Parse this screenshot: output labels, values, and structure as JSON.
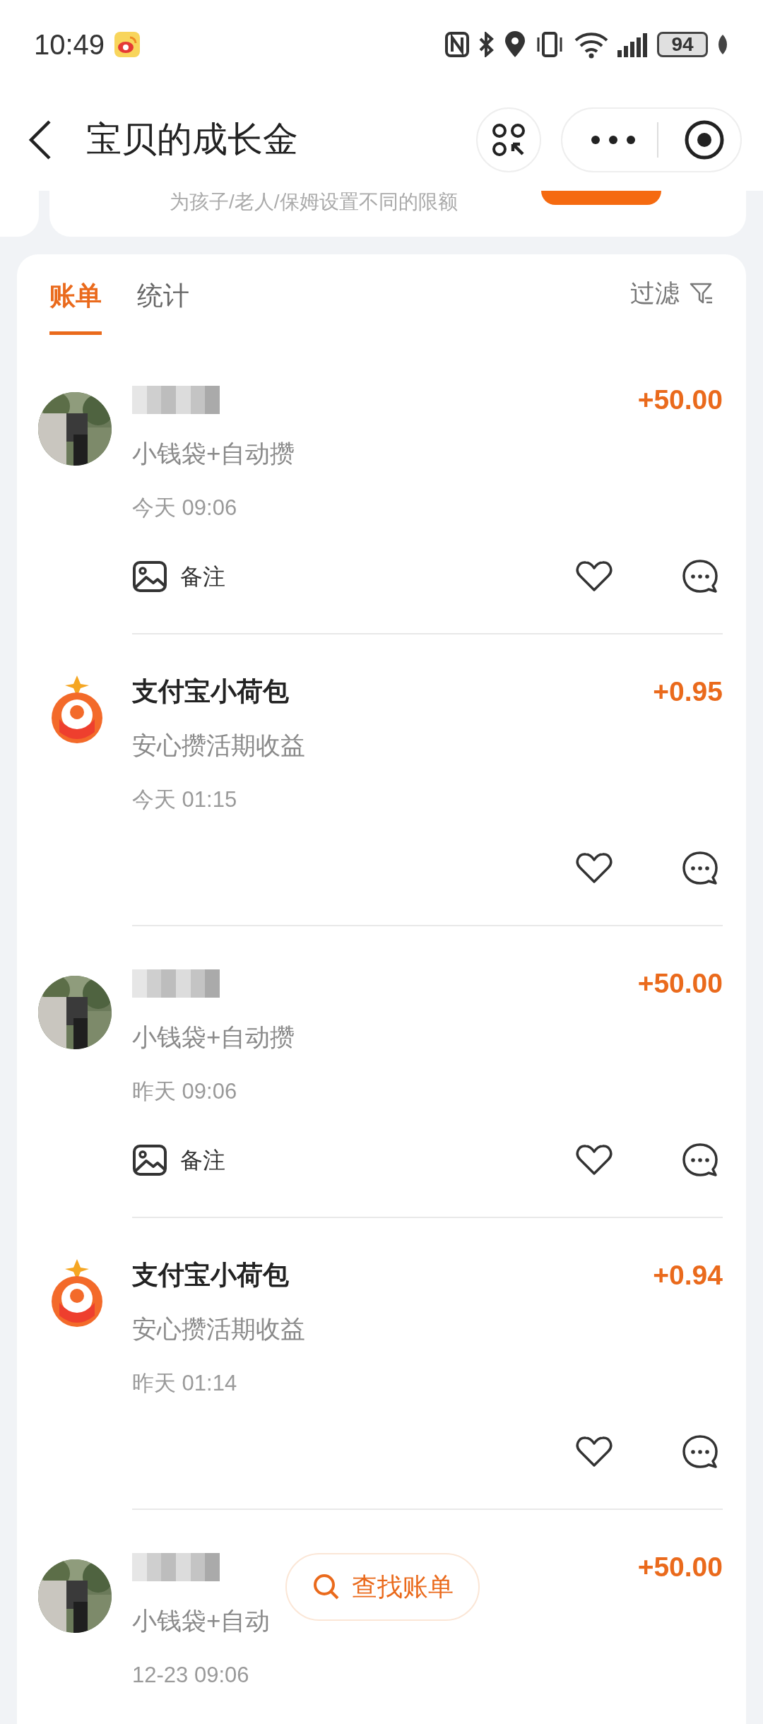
{
  "status_bar": {
    "time": "10:49",
    "battery": "94"
  },
  "header": {
    "title": "宝贝的成长金"
  },
  "promo_card": {
    "subtitle": "为孩子/老人/保姆设置不同的限额"
  },
  "tabs": [
    {
      "label": "账单",
      "selected": true
    },
    {
      "label": "统计",
      "selected": false
    }
  ],
  "filter": {
    "label": "过滤"
  },
  "bills": [
    {
      "amount": "+50.00",
      "subtitle": "小钱袋+自动攒",
      "time": "今天 09:06",
      "note": "备注"
    },
    {
      "avatar": {
        "kind": "logo"
      },
      "title": "支付宝小荷包",
      "amount": "+0.95",
      "subtitle": "安心攒活期收益",
      "time": "今天 01:15"
    },
    {
      "amount": "+50.00",
      "subtitle": "小钱袋+自动攒",
      "time": "昨天 09:06",
      "note": "备注"
    },
    {
      "avatar": {
        "kind": "logo"
      },
      "title": "支付宝小荷包",
      "amount": "+0.94",
      "subtitle": "安心攒活期收益",
      "time": "昨天 01:14"
    },
    {
      "amount": "+50.00",
      "subtitle": "小钱袋+自动",
      "time": "12-23 09:06"
    }
  ],
  "find_button": {
    "label": "查找账单"
  }
}
